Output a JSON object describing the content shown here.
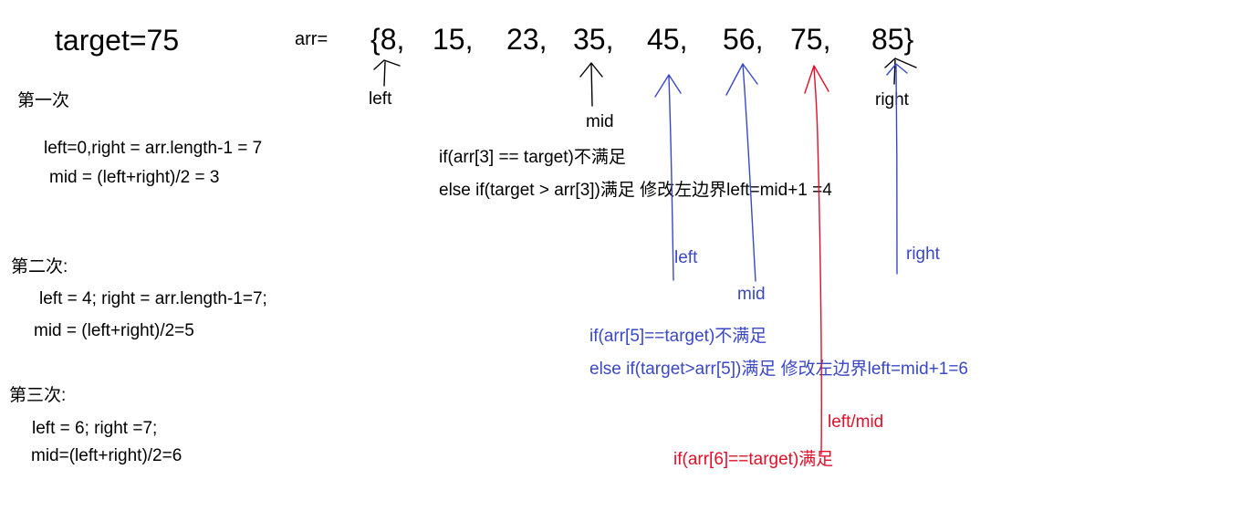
{
  "header": {
    "target": "target=75",
    "arr_label": "arr=",
    "array": [
      "{8,",
      "15,",
      "23,",
      "35,",
      "45,",
      "56,",
      "75,",
      "85}"
    ]
  },
  "round1": {
    "heading": "第一次",
    "line1": "left=0,right = arr.length-1 = 7",
    "line2": "mid = (left+right)/2 = 3",
    "pointer_left": "left",
    "pointer_mid": "mid",
    "pointer_right": "right",
    "cond1": "if(arr[3] == target)不满足",
    "cond2": "else if(target > arr[3])满足  修改左边界left=mid+1 =4"
  },
  "round2": {
    "heading": "第二次:",
    "line1": "left = 4; right = arr.length-1=7;",
    "line2": "mid = (left+right)/2=5",
    "pointer_left": "left",
    "pointer_mid": "mid",
    "pointer_right": "right",
    "cond1": "if(arr[5]==target)不满足",
    "cond2": "else if(target>arr[5])满足  修改左边界left=mid+1=6"
  },
  "round3": {
    "heading": "第三次:",
    "line1": "left = 6; right =7;",
    "line2": "mid=(left+right)/2=6",
    "pointer_leftmid": "left/mid",
    "cond1": "if(arr[6]==target)满足"
  },
  "colors": {
    "text": "#000000",
    "round2": "#3a48c4",
    "round3": "#e0102a"
  }
}
